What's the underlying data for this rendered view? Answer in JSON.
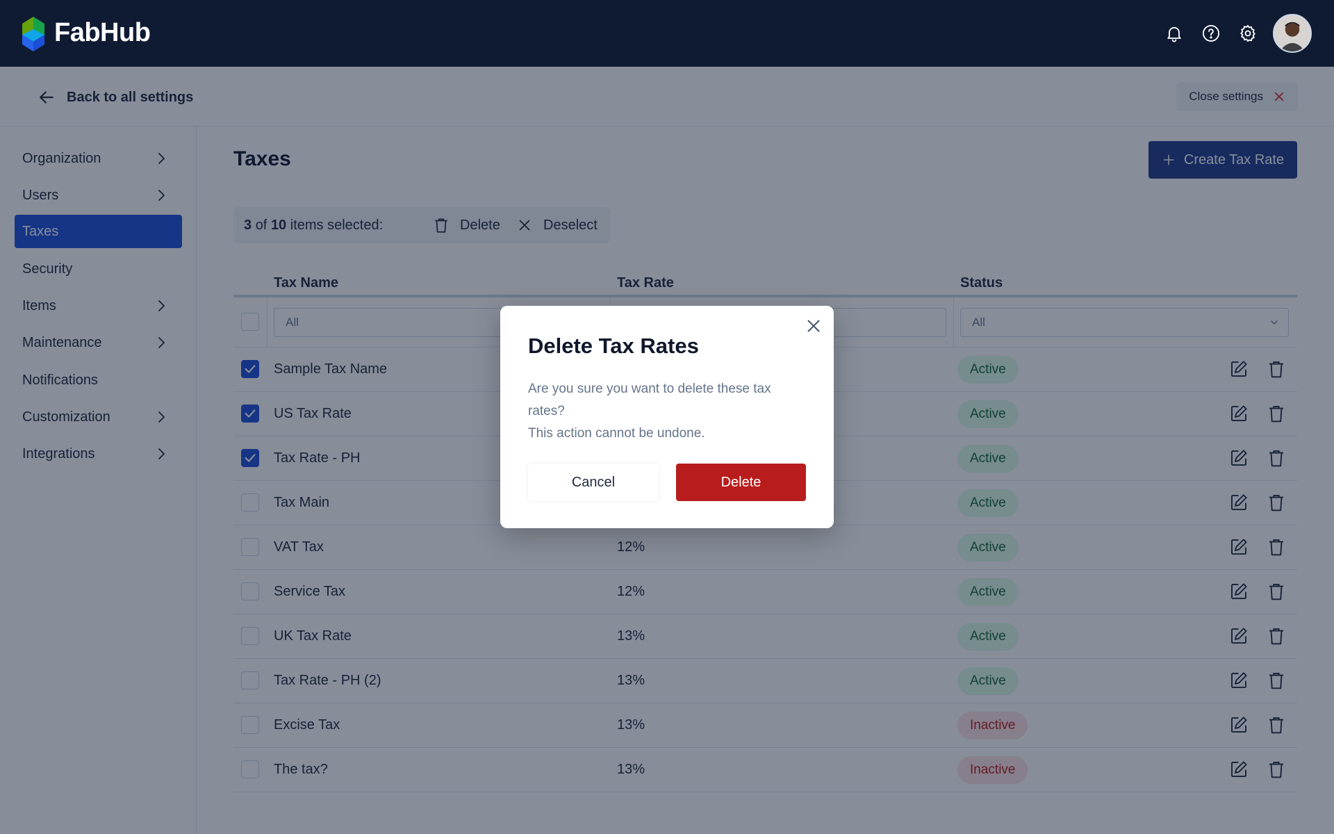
{
  "app": {
    "name": "FabHub",
    "colors": {
      "topbar": "#0f1b33",
      "accent": "#1d4ed8",
      "primary_button": "#1e3a8a",
      "danger": "#b91c1c"
    }
  },
  "topbar": {
    "icons": [
      "bell-icon",
      "help-icon",
      "gear-icon"
    ]
  },
  "settings_bar": {
    "back_label": "Back to all settings",
    "close_label": "Close settings"
  },
  "sidebar": {
    "items": [
      {
        "label": "Organization",
        "has_children": true
      },
      {
        "label": "Users",
        "has_children": true
      },
      {
        "label": "Taxes",
        "has_children": false,
        "active": true
      },
      {
        "label": "Security",
        "has_children": false
      },
      {
        "label": "Items",
        "has_children": true
      },
      {
        "label": "Maintenance",
        "has_children": true
      },
      {
        "label": "Notifications",
        "has_children": false
      },
      {
        "label": "Customization",
        "has_children": true
      },
      {
        "label": "Integrations",
        "has_children": true
      }
    ]
  },
  "main": {
    "title": "Taxes",
    "create_label": "Create Tax Rate",
    "selection": {
      "selected": "3",
      "of_text": "of",
      "total": "10",
      "suffix": "items selected:",
      "delete_label": "Delete",
      "deselect_label": "Deselect"
    }
  },
  "table": {
    "headers": {
      "name": "Tax Name",
      "rate": "Tax Rate",
      "status": "Status"
    },
    "filters": {
      "name_value": "All",
      "status_value": "All"
    },
    "rows": [
      {
        "name": "Sample Tax Name",
        "rate": "",
        "status": "Active",
        "checked": true
      },
      {
        "name": "US Tax Rate",
        "rate": "",
        "status": "Active",
        "checked": true
      },
      {
        "name": "Tax Rate - PH",
        "rate": "",
        "status": "Active",
        "checked": true
      },
      {
        "name": "Tax Main",
        "rate": "",
        "status": "Active",
        "checked": false
      },
      {
        "name": "VAT Tax",
        "rate": "12%",
        "status": "Active",
        "checked": false
      },
      {
        "name": "Service Tax",
        "rate": "12%",
        "status": "Active",
        "checked": false
      },
      {
        "name": "UK Tax Rate",
        "rate": "13%",
        "status": "Active",
        "checked": false
      },
      {
        "name": "Tax Rate - PH (2)",
        "rate": "13%",
        "status": "Active",
        "checked": false
      },
      {
        "name": "Excise Tax",
        "rate": "13%",
        "status": "Inactive",
        "checked": false
      },
      {
        "name": "The tax?",
        "rate": "13%",
        "status": "Inactive",
        "checked": false
      }
    ]
  },
  "modal": {
    "title": "Delete Tax Rates",
    "body_line1": "Are you sure you want to delete these tax rates?",
    "body_line2": "This action cannot be undone.",
    "cancel_label": "Cancel",
    "delete_label": "Delete"
  }
}
